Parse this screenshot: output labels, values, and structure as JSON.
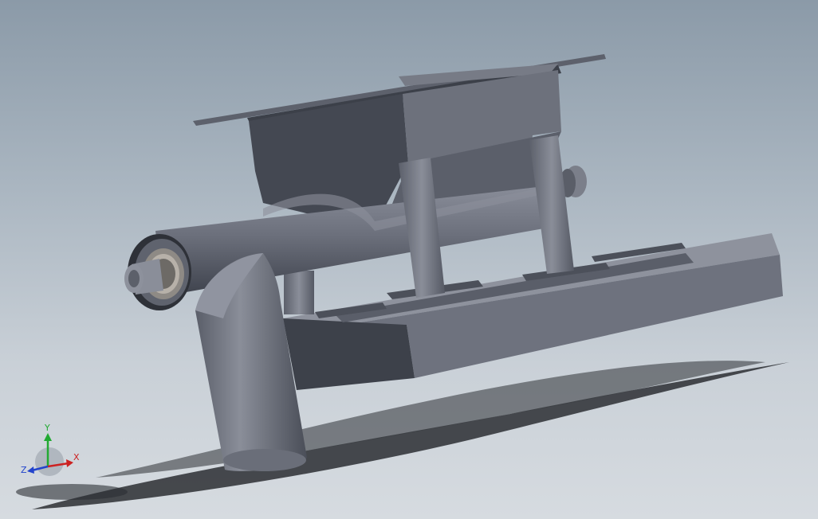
{
  "viewport": {
    "background_top": "#8b9aa8",
    "background_bottom": "#d6dbe0"
  },
  "model": {
    "body_color": "#6b6f7a",
    "dark_color": "#3f434d",
    "light_color": "#868a96",
    "shadow_color": "#2e3136"
  },
  "triad": {
    "x_label": "X",
    "y_label": "Y",
    "z_label": "Z",
    "x_color": "#cc2222",
    "y_color": "#22aa33",
    "z_color": "#2244cc"
  }
}
